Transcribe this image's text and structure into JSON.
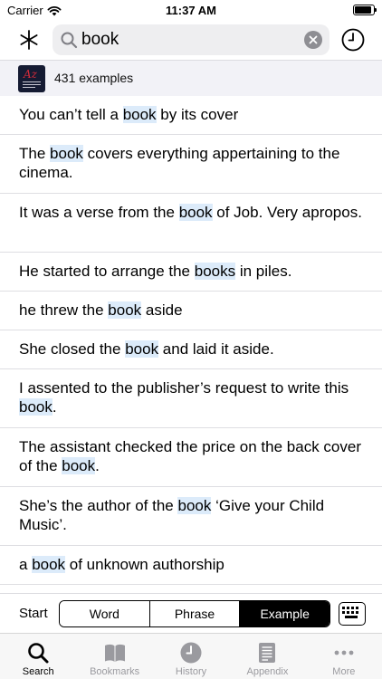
{
  "status_bar": {
    "carrier": "Carrier",
    "time": "11:37 AM",
    "battery_level": 0.92
  },
  "search": {
    "query": "book",
    "icons": {
      "left": "asterisk-icon",
      "field": "search-icon",
      "clear": "clear-icon",
      "right": "clock-icon"
    }
  },
  "results": {
    "count_text": "431 examples",
    "dictionary_logo": "dictionary-thesaurus-logo",
    "items": [
      {
        "pre": "You can’t tell a ",
        "match": "book",
        "post": " by its cover"
      },
      {
        "pre": "The ",
        "match": "book",
        "post": " covers everything appertaining to the cinema."
      },
      {
        "pre": "It was a verse from the ",
        "match": "book",
        "post": " of Job. Very apropos."
      },
      {
        "pre": "He started to arrange the ",
        "match": "books",
        "post": " in piles."
      },
      {
        "pre": "he threw the ",
        "match": "book",
        "post": " aside"
      },
      {
        "pre": "She closed the ",
        "match": "book",
        "post": " and laid it aside."
      },
      {
        "pre": "I assented to the publisher’s request to write this ",
        "match": "book",
        "post": "."
      },
      {
        "pre": "The assistant checked the price on the back cover of the ",
        "match": "book",
        "post": "."
      },
      {
        "pre": "She’s the author of the ",
        "match": "book",
        "post": " ‘Give your Child Music’."
      },
      {
        "pre": "a ",
        "match": "book",
        "post": " of unknown authorship"
      }
    ]
  },
  "mode_bar": {
    "start_label": "Start",
    "segments": [
      "Word",
      "Phrase",
      "Example"
    ],
    "selected": "Example",
    "keyboard_icon": "keyboard-icon"
  },
  "tab_bar": {
    "tabs": [
      {
        "label": "Search",
        "icon": "search-icon",
        "active": true
      },
      {
        "label": "Bookmarks",
        "icon": "book-icon",
        "active": false
      },
      {
        "label": "History",
        "icon": "clock-icon",
        "active": false
      },
      {
        "label": "Appendix",
        "icon": "document-icon",
        "active": false
      },
      {
        "label": "More",
        "icon": "more-icon",
        "active": false
      }
    ]
  },
  "colors": {
    "highlight": "#dcebfa",
    "header_bg": "#f2f2f7",
    "tab_inactive": "#9a9a9f",
    "logo_bg": "#151b33",
    "logo_accent": "#d22b3a"
  }
}
